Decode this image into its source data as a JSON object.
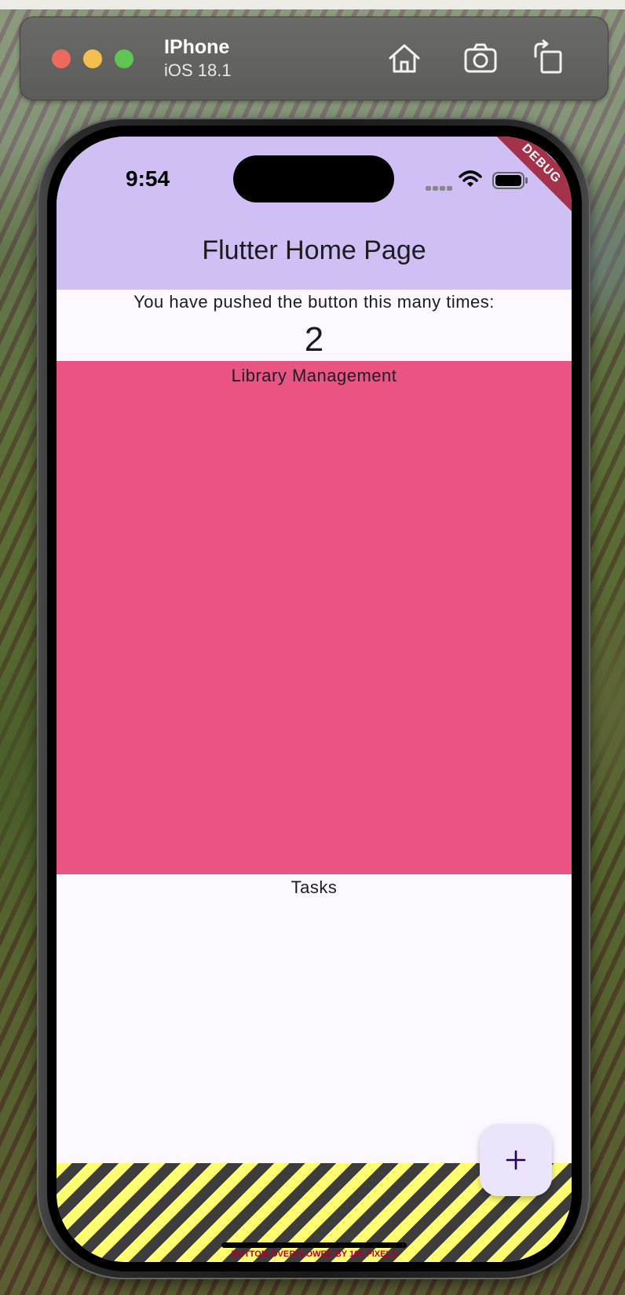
{
  "simulator": {
    "device_name": "IPhone",
    "os_version": "iOS 18.1",
    "toolbar_icons": [
      "home-icon",
      "screenshot-camera-icon",
      "rotate-icon"
    ]
  },
  "status_bar": {
    "time": "9:54"
  },
  "debug_banner": "DEBUG",
  "app_bar": {
    "title": "Flutter Home Page"
  },
  "body": {
    "counter_label": "You have pushed the button this many times:",
    "counter_value": "2",
    "library_section": {
      "label": "Library Management",
      "color": "#ea5482"
    },
    "tasks_label": "Tasks"
  },
  "overflow_error": "BOTTOM OVERFLOWED BY 100 PIXELS",
  "fab": {
    "icon": "add-icon"
  },
  "colors": {
    "app_bar": "#cfbff4",
    "background": "#fdf7ff",
    "fab": "#ece4fb"
  }
}
